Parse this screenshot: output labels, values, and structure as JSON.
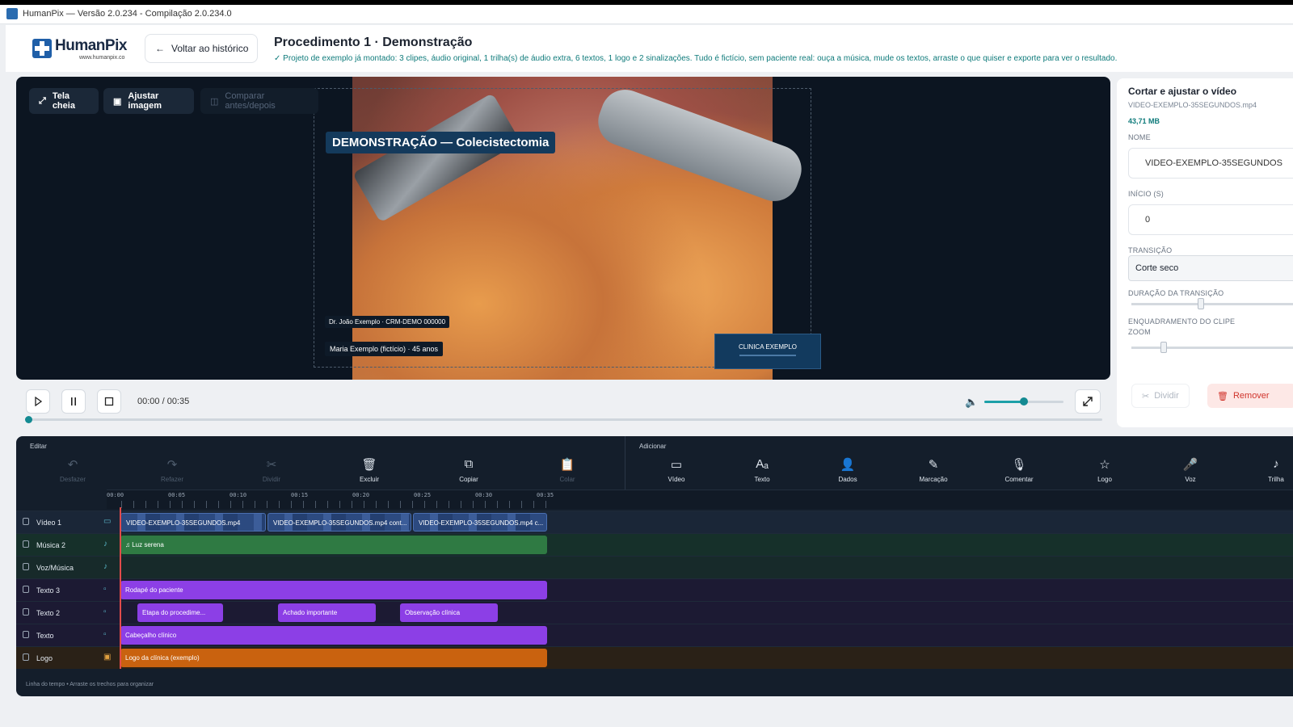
{
  "window": {
    "title": "HumanPix — Versão 2.0.234 - Compilação 2.0.234.0"
  },
  "header": {
    "logo_text": "HumanPix",
    "logo_url": "www.humanpix.co",
    "back_label": "Voltar ao histórico",
    "title": "Procedimento 1 · Demonstração",
    "subtitle": "✓  Projeto de exemplo já montado: 3 clipes, áudio original, 1 trilha(s) de áudio extra, 6 textos, 1 logo e 2 sinalizações. Tudo é fictício, sem paciente real: ouça a música, mude os textos, arraste o que quiser e exporte para ver o resultado."
  },
  "viewer": {
    "fullscreen_label": "Tela cheia",
    "adjust_label": "Ajustar imagem",
    "compare_label": "Comparar antes/depois",
    "overlay_title": "DEMONSTRAÇÃO — Colecistectomia",
    "overlay_doctor": "Dr. João Exemplo · CRM-DEMO 000000",
    "overlay_patient": "Maria Exemplo (fictício) · 45 anos",
    "overlay_logo": "CLINICA EXEMPLO"
  },
  "transport": {
    "timecode": "00:00 / 00:35",
    "volume_fraction": 0.5,
    "progress_fraction": 0
  },
  "panel": {
    "title": "Cortar e ajustar o vídeo",
    "file": "VIDEO-EXEMPLO-35SEGUNDOS.mp4",
    "size": "43,71 MB",
    "name_label": "NOME",
    "name_value": "VIDEO-EXEMPLO-35SEGUNDOS",
    "start_label": "INÍCIO (s)",
    "start_value": "0",
    "transition_label": "TRANSIÇÃO",
    "transition_value": "Corte seco",
    "transition_duration_label": "DURAÇÃO DA TRANSIÇÃO",
    "framing_label": "ENQUADRAMENTO DO CLIPE",
    "zoom_label": "ZOOM",
    "split_label": "Dividir",
    "remove_label": "Remover"
  },
  "timeline": {
    "edit_section": "Editar",
    "add_section": "Adicionar",
    "edit_tools": [
      "Desfazer",
      "Refazer",
      "Dividir",
      "Excluir",
      "Copiar",
      "Colar"
    ],
    "add_tools": [
      "Vídeo",
      "Texto",
      "Dados",
      "Marcação",
      "Comentar",
      "Logo",
      "Voz",
      "Trilha"
    ],
    "ruler": [
      "00:00",
      "00:05",
      "00:10",
      "00:15",
      "00:20",
      "00:25",
      "00:30",
      "00:35"
    ],
    "tracks": [
      "Vídeo 1",
      "Música 2",
      "Voz/Música",
      "Texto 3",
      "Texto 2",
      "Texto",
      "Logo"
    ],
    "clips": {
      "video1": "VIDEO-EXEMPLO-35SEGUNDOS.mp4",
      "video2": "VIDEO-EXEMPLO-35SEGUNDOS.mp4 cont...",
      "video3": "VIDEO-EXEMPLO-35SEGUNDOS.mp4 c...",
      "music": "Luz serena",
      "text3": "Rodapé do paciente",
      "text2a": "Etapa do procedime...",
      "text2b": "Achado importante",
      "text2c": "Observação clínica",
      "text1": "Cabeçalho clínico",
      "logo": "Logo da clínica (exemplo)"
    },
    "footer": "Linha do tempo  •  Arraste os trechos para organizar"
  }
}
